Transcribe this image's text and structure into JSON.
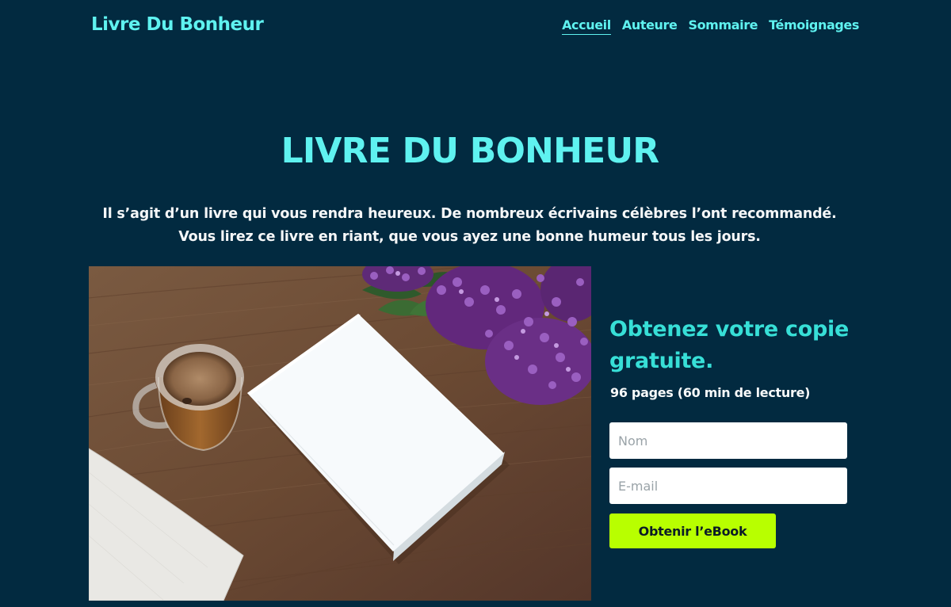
{
  "header": {
    "brand": "Livre Du Bonheur",
    "nav": [
      {
        "label": "Accueil",
        "active": true
      },
      {
        "label": "Auteure",
        "active": false
      },
      {
        "label": "Sommaire",
        "active": false
      },
      {
        "label": "Témoignages",
        "active": false
      }
    ]
  },
  "hero": {
    "title": "LIVRE DU BONHEUR",
    "description": "Il s’agit d’un livre qui vous rendra heureux. De nombreux écrivains célèbres l’ont recommandé. Vous lirez ce livre en riant, que vous ayez une bonne humeur tous les jours."
  },
  "signup": {
    "title": "Obtenez votre copie gratuite.",
    "subtitle": "96 pages (60 min de lecture)",
    "name_placeholder": "Nom",
    "email_placeholder": "E-mail",
    "button_label": "Obtenir l’eBook"
  },
  "colors": {
    "background": "#022a40",
    "accent": "#5ff2f0",
    "button": "#b8ff00"
  }
}
